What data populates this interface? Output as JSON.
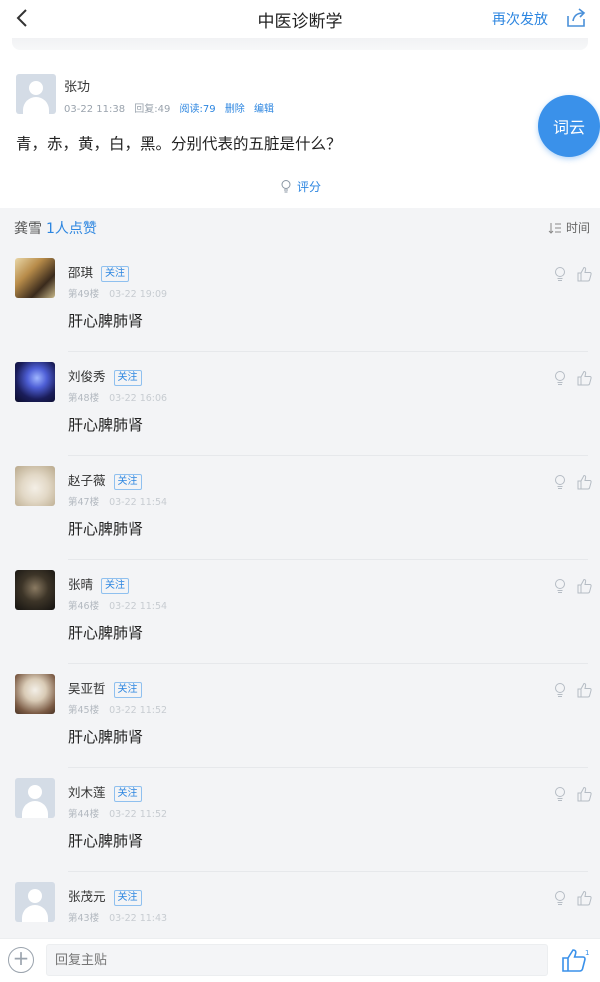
{
  "header": {
    "title": "中医诊断学",
    "redo_label": "再次发放"
  },
  "post": {
    "author": "张功",
    "date": "03-22 11:38",
    "replies": "回复:49",
    "reads": "阅读:79",
    "delete_label": "删除",
    "edit_label": "编辑",
    "content": "青，赤，黄，白，黑。分别代表的五脏是什么？",
    "rate_label": "评分"
  },
  "ciyun_label": "词云",
  "likes": {
    "prefix": "龚雪",
    "count": "1人点赞"
  },
  "sort_label": "时间",
  "replies": [
    {
      "name": "邵琪",
      "floor": "第49楼",
      "time": "03-22 19:09",
      "text": "肝心脾肺肾",
      "follow": "关注"
    },
    {
      "name": "刘俊秀",
      "floor": "第48楼",
      "time": "03-22 16:06",
      "text": "肝心脾肺肾",
      "follow": "关注"
    },
    {
      "name": "赵子薇",
      "floor": "第47楼",
      "time": "03-22 11:54",
      "text": "肝心脾肺肾",
      "follow": "关注"
    },
    {
      "name": "张晴",
      "floor": "第46楼",
      "time": "03-22 11:54",
      "text": "肝心脾肺肾",
      "follow": "关注"
    },
    {
      "name": "吴亚哲",
      "floor": "第45楼",
      "time": "03-22 11:52",
      "text": "肝心脾肺肾",
      "follow": "关注"
    },
    {
      "name": "刘木莲",
      "floor": "第44楼",
      "time": "03-22 11:52",
      "text": "肝心脾肺肾",
      "follow": "关注"
    },
    {
      "name": "张茂元",
      "floor": "第43楼",
      "time": "03-22 11:43",
      "text": "",
      "follow": "关注"
    }
  ],
  "bottom": {
    "reply_placeholder": "回复主贴"
  }
}
